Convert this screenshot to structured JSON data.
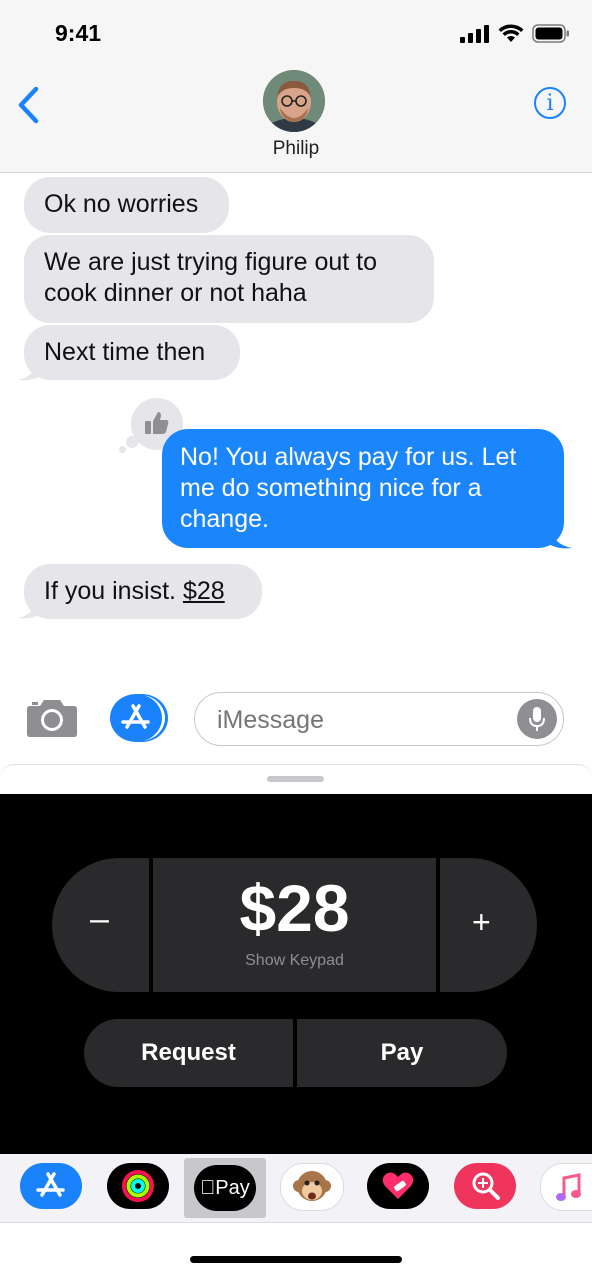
{
  "status_bar": {
    "time": "9:41"
  },
  "header": {
    "contact_name": "Philip"
  },
  "messages": [
    {
      "dir": "in",
      "text": "Ok no worries"
    },
    {
      "dir": "in",
      "text": "We are just trying figure out to cook dinner or not haha"
    },
    {
      "dir": "in",
      "text": "Next time then"
    },
    {
      "dir": "out",
      "text": "No! You always pay for us. Let me do something nice for a change.",
      "tapback": "thumbs-up-icon"
    },
    {
      "dir": "in",
      "text_prefix": "If you insist. ",
      "link": "$28"
    }
  ],
  "composer": {
    "placeholder": "iMessage"
  },
  "apple_pay": {
    "amount": "$28",
    "show_keypad": "Show Keypad",
    "minus": "–",
    "plus": "+",
    "request": "Request",
    "pay": "Pay"
  },
  "app_strip": {
    "apple_pay_label": "Pay",
    "apps": [
      "app-store-icon",
      "activity-icon",
      "apple-pay-icon",
      "animoji-icon",
      "heart-sticker-icon",
      "search-images-icon",
      "music-icon"
    ]
  },
  "colors": {
    "accent": "#1a82fb",
    "incoming": "#e5e5ea",
    "outgoing": "#1b86fb",
    "panel": "#000000",
    "segment": "#2a2a2c"
  }
}
